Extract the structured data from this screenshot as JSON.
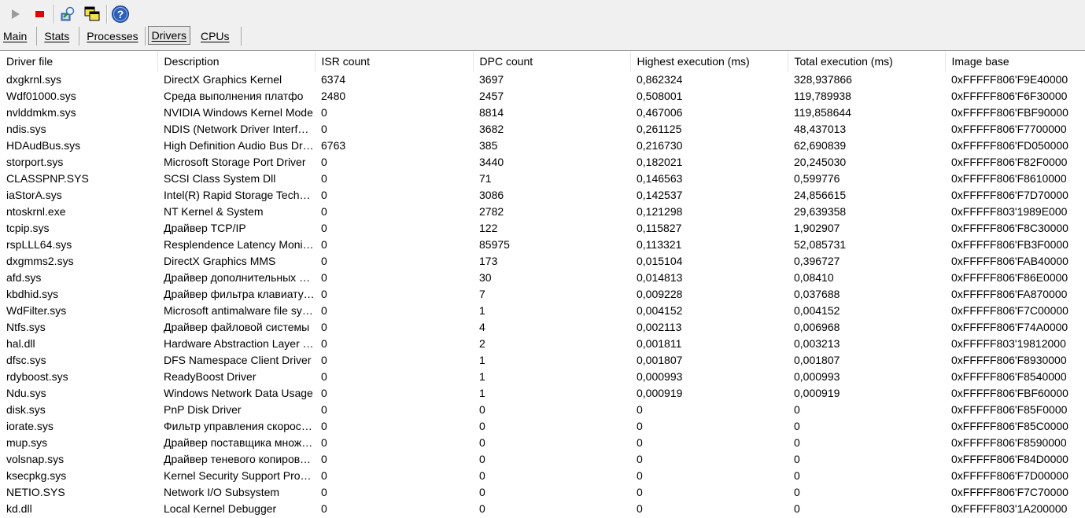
{
  "toolbar": {
    "buttons": [
      {
        "name": "start",
        "icon": "play-icon",
        "color": "#9a9a9a"
      },
      {
        "name": "stop",
        "icon": "stop-icon",
        "color": "#e00000"
      },
      {
        "name": "analyze",
        "icon": "analyze-icon"
      },
      {
        "name": "copy",
        "icon": "copy-windows-icon"
      },
      {
        "name": "help",
        "icon": "help-icon",
        "color": "#2c5fb8"
      }
    ]
  },
  "tabs": [
    {
      "label": "Main",
      "active": false
    },
    {
      "label": "Stats",
      "active": false
    },
    {
      "label": "Processes",
      "active": false
    },
    {
      "label": "Drivers",
      "active": true
    },
    {
      "label": "CPUs",
      "active": false
    }
  ],
  "table": {
    "columns": [
      "Driver file",
      "Description",
      "ISR count",
      "DPC count",
      "Highest execution (ms)",
      "Total execution (ms)",
      "Image base"
    ],
    "rows": [
      [
        "dxgkrnl.sys",
        "DirectX Graphics Kernel",
        "6374",
        "3697",
        "0,862324",
        "328,937866",
        "0xFFFFF806'F9E40000"
      ],
      [
        "Wdf01000.sys",
        "Среда выполнения платфо",
        "2480",
        "2457",
        "0,508001",
        "119,789938",
        "0xFFFFF806'F6F30000"
      ],
      [
        "nvlddmkm.sys",
        "NVIDIA Windows Kernel Mode",
        "0",
        "8814",
        "0,467006",
        "119,858644",
        "0xFFFFF806'FBF90000"
      ],
      [
        "ndis.sys",
        "NDIS (Network Driver Interface",
        "0",
        "3682",
        "0,261125",
        "48,437013",
        "0xFFFFF806'F7700000"
      ],
      [
        "HDAudBus.sys",
        "High Definition Audio Bus Driver",
        "6763",
        "385",
        "0,216730",
        "62,690839",
        "0xFFFFF806'FD050000"
      ],
      [
        "storport.sys",
        "Microsoft Storage Port Driver",
        "0",
        "3440",
        "0,182021",
        "20,245030",
        "0xFFFFF806'F82F0000"
      ],
      [
        "CLASSPNP.SYS",
        "SCSI Class System Dll",
        "0",
        "71",
        "0,146563",
        "0,599776",
        "0xFFFFF806'F8610000"
      ],
      [
        "iaStorA.sys",
        "Intel(R) Rapid Storage Technology",
        "0",
        "3086",
        "0,142537",
        "24,856615",
        "0xFFFFF806'F7D70000"
      ],
      [
        "ntoskrnl.exe",
        "NT Kernel & System",
        "0",
        "2782",
        "0,121298",
        "29,639358",
        "0xFFFFF803'1989E000"
      ],
      [
        "tcpip.sys",
        "Драйвер TCP/IP",
        "0",
        "122",
        "0,115827",
        "1,902907",
        "0xFFFFF806'F8C30000"
      ],
      [
        "rspLLL64.sys",
        "Resplendence Latency Monitor",
        "0",
        "85975",
        "0,113321",
        "52,085731",
        "0xFFFFF806'FB3F0000"
      ],
      [
        "dxgmms2.sys",
        "DirectX Graphics MMS",
        "0",
        "173",
        "0,015104",
        "0,396727",
        "0xFFFFF806'FAB40000"
      ],
      [
        "afd.sys",
        "Драйвер дополнительных функций",
        "0",
        "30",
        "0,014813",
        "0,08410",
        "0xFFFFF806'F86E0000"
      ],
      [
        "kbdhid.sys",
        "Драйвер фильтра клавиатуры",
        "0",
        "7",
        "0,009228",
        "0,037688",
        "0xFFFFF806'FA870000"
      ],
      [
        "WdFilter.sys",
        "Microsoft antimalware file system",
        "0",
        "1",
        "0,004152",
        "0,004152",
        "0xFFFFF806'F7C00000"
      ],
      [
        "Ntfs.sys",
        "Драйвер файловой системы",
        "0",
        "4",
        "0,002113",
        "0,006968",
        "0xFFFFF806'F74A0000"
      ],
      [
        "hal.dll",
        "Hardware Abstraction Layer DLL",
        "0",
        "2",
        "0,001811",
        "0,003213",
        "0xFFFFF803'19812000"
      ],
      [
        "dfsc.sys",
        "DFS Namespace Client Driver",
        "0",
        "1",
        "0,001807",
        "0,001807",
        "0xFFFFF806'F8930000"
      ],
      [
        "rdyboost.sys",
        "ReadyBoost Driver",
        "0",
        "1",
        "0,000993",
        "0,000993",
        "0xFFFFF806'F8540000"
      ],
      [
        "Ndu.sys",
        "Windows Network Data Usage",
        "0",
        "1",
        "0,000919",
        "0,000919",
        "0xFFFFF806'FBF60000"
      ],
      [
        "disk.sys",
        "PnP Disk Driver",
        "0",
        "0",
        "0",
        "0",
        "0xFFFFF806'F85F0000"
      ],
      [
        "iorate.sys",
        "Фильтр управления скоростью",
        "0",
        "0",
        "0",
        "0",
        "0xFFFFF806'F85C0000"
      ],
      [
        "mup.sys",
        "Драйвер поставщика множественного",
        "0",
        "0",
        "0",
        "0",
        "0xFFFFF806'F8590000"
      ],
      [
        "volsnap.sys",
        "Драйвер теневого копирования",
        "0",
        "0",
        "0",
        "0",
        "0xFFFFF806'F84D0000"
      ],
      [
        "ksecpkg.sys",
        "Kernel Security Support Provider",
        "0",
        "0",
        "0",
        "0",
        "0xFFFFF806'F7D00000"
      ],
      [
        "NETIO.SYS",
        "Network I/O Subsystem",
        "0",
        "0",
        "0",
        "0",
        "0xFFFFF806'F7C70000"
      ],
      [
        "kd.dll",
        "Local Kernel Debugger",
        "0",
        "0",
        "0",
        "0",
        "0xFFFFF803'1A200000"
      ]
    ]
  }
}
